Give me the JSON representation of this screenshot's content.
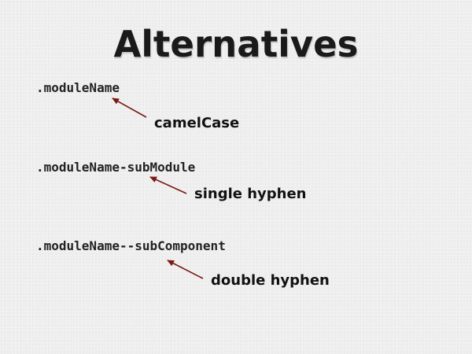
{
  "slide": {
    "title": "Alternatives",
    "items": [
      {
        "code": ".moduleName",
        "note": "camelCase"
      },
      {
        "code": ".moduleName-subModule",
        "note": "single hyphen"
      },
      {
        "code": ".moduleName--subComponent",
        "note": "double hyphen"
      }
    ]
  },
  "colors": {
    "background": "#efefef",
    "text": "#222222",
    "arrow": "#7a1a14"
  }
}
